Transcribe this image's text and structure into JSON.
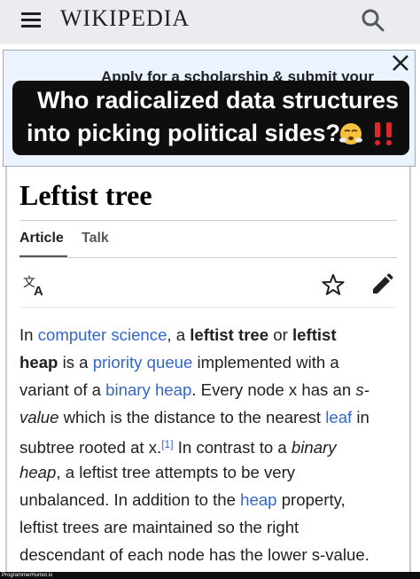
{
  "header": {
    "menu_icon": "hamburger-menu-icon",
    "wordmark": "WIKIPEDIA",
    "search_icon": "search-icon"
  },
  "banner": {
    "text": "Apply for a scholarship & submit your",
    "close_icon": "close-icon"
  },
  "meme": {
    "line1": "Who radicalized data structures",
    "line2": "into picking political sides?",
    "emojis": [
      "face-with-steam-emoji",
      "double-exclamation-emoji"
    ]
  },
  "article": {
    "title": "Leftist tree",
    "tabs": [
      {
        "label": "Article",
        "selected": true
      },
      {
        "label": "Talk",
        "selected": false
      }
    ],
    "icons": [
      "language-icon",
      "star-icon",
      "edit-pencil-icon"
    ],
    "paragraph": {
      "l1": {
        "a": "In ",
        "link1": "computer science",
        "b": ", a ",
        "bold1": "leftist tree",
        "c": " or ",
        "bold2": "leftist"
      },
      "l2": {
        "bold": "heap",
        "a": " is a ",
        "link": "priority queue",
        "b": " implemented with a"
      },
      "l3": {
        "a": "variant of a ",
        "link": "binary heap",
        "b": ". Every node x has an ",
        "italic": "s-"
      },
      "l4": {
        "italic": "value",
        "a": " which is the distance to the nearest ",
        "link": "leaf",
        "b": " in"
      },
      "l5": {
        "a": "subtree rooted at x.",
        "ref": "[1]",
        "b": " In contrast to a ",
        "italic": "binary"
      },
      "l6": {
        "italic": "heap",
        "a": ", a leftist tree attempts to be very"
      },
      "l7": {
        "a": "unbalanced. In addition to the ",
        "link": "heap",
        "b": " property,"
      },
      "l8": {
        "a": "leftist trees are maintained so the right"
      },
      "l9": {
        "a": "descendant of each node has the lower s-value."
      }
    }
  },
  "footer": {
    "watermark": "ProgrammerHumor.io"
  },
  "colors": {
    "link": "#3366cc",
    "header_bg": "#eaecf0",
    "banner_bg": "#eaf3ff",
    "meme_bg": "#0e0e0e",
    "text": "#202122"
  }
}
